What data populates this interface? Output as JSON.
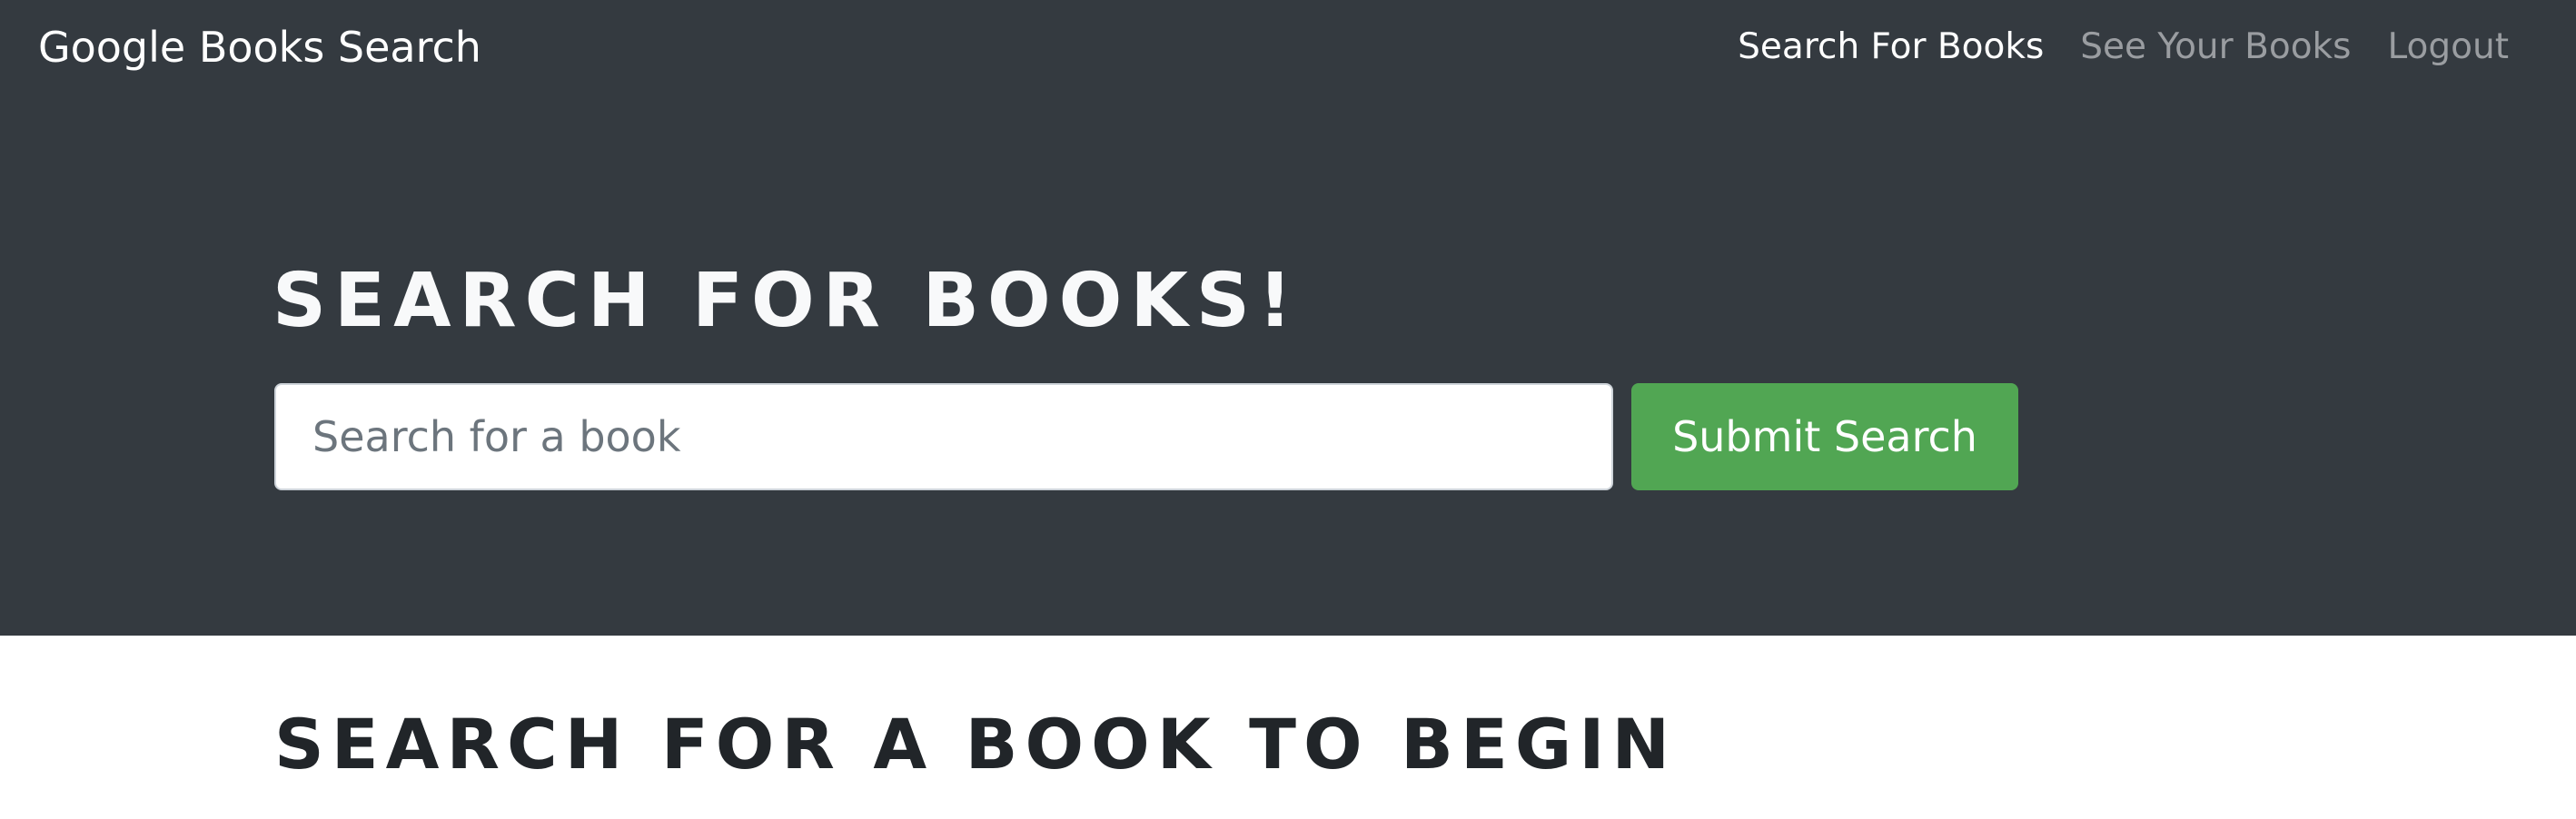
{
  "navbar": {
    "brand": "Google Books Search",
    "links": [
      {
        "label": "Search For Books",
        "active": true
      },
      {
        "label": "See Your Books",
        "active": false
      },
      {
        "label": "Logout",
        "active": false
      }
    ]
  },
  "hero": {
    "title": "SEARCH FOR BOOKS!"
  },
  "search": {
    "placeholder": "Search for a book",
    "value": "",
    "submit_label": "Submit Search"
  },
  "results": {
    "heading": "SEARCH FOR A BOOK TO BEGIN"
  },
  "colors": {
    "header_background": "#343a40",
    "submit_button": "#51a653",
    "heading_dark": "#212529"
  }
}
